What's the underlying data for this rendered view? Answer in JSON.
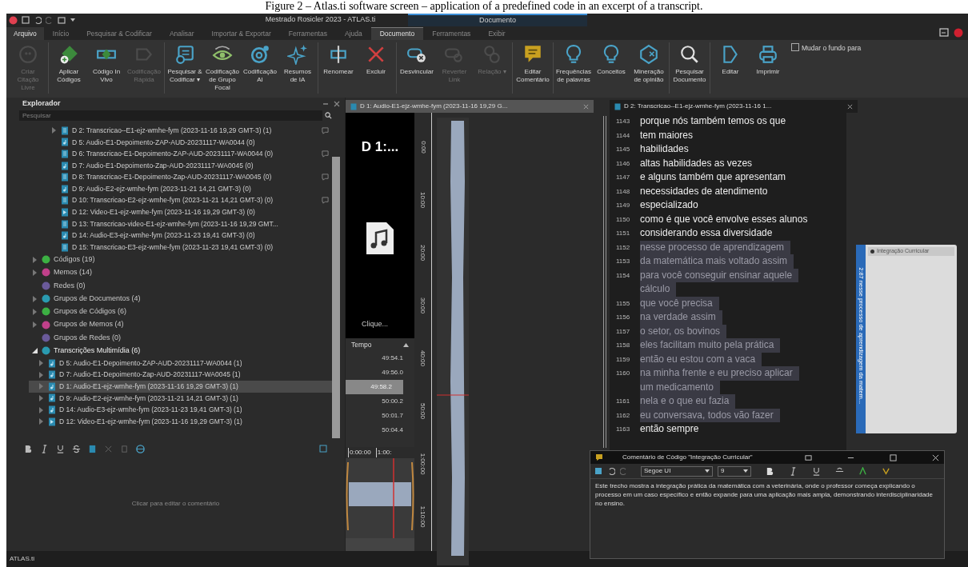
{
  "caption": "Figure 2 – Atlas.ti software screen – application of a predefined code in an excerpt of a transcript.",
  "window": {
    "title": "Mestrado Rosicler 2023 - ATLAS.ti",
    "contextual_tab": "Documento"
  },
  "ribbon_tabs": [
    {
      "label": "Arquivo",
      "kind": "menu",
      "selected": false
    },
    {
      "label": "Início",
      "kind": "tab",
      "selected": false
    },
    {
      "label": "Pesquisar & Codificar",
      "kind": "tab",
      "selected": false
    },
    {
      "label": "Analisar",
      "kind": "tab",
      "selected": false
    },
    {
      "label": "Importar & Exportar",
      "kind": "tab",
      "selected": false
    },
    {
      "label": "Ferramentas",
      "kind": "tab",
      "selected": false
    },
    {
      "label": "Ajuda",
      "kind": "tab",
      "selected": false
    },
    {
      "label": "Documento",
      "kind": "tab",
      "selected": true
    },
    {
      "label": "Ferramentas",
      "kind": "tab",
      "selected": false
    },
    {
      "label": "Exibir",
      "kind": "tab",
      "selected": false
    }
  ],
  "ribbon_groups": [
    [
      {
        "label": "Criar Citação Livre",
        "disabled": true
      }
    ],
    [
      {
        "label": "Aplicar Códigos",
        "disabled": false
      },
      {
        "label": "Código In Vivo",
        "disabled": false
      },
      {
        "label": "Codificação Rápida",
        "disabled": true
      }
    ],
    [
      {
        "label": "Pesquisar & Codificar ▾",
        "disabled": false
      },
      {
        "label": "Codificação de Grupo Focal",
        "disabled": false
      },
      {
        "label": "Codificação AI",
        "disabled": false
      },
      {
        "label": "Resumos de IA",
        "disabled": false
      }
    ],
    [
      {
        "label": "Renomear",
        "disabled": false
      },
      {
        "label": "Excluir",
        "disabled": false
      }
    ],
    [
      {
        "label": "Desvincular",
        "disabled": false
      },
      {
        "label": "Reverter Link",
        "disabled": true
      },
      {
        "label": "Relação ▾",
        "disabled": true
      }
    ],
    [
      {
        "label": "Editar Comentário",
        "disabled": false
      }
    ],
    [
      {
        "label": "Frequências de palavras",
        "disabled": false
      },
      {
        "label": "Conceitos",
        "disabled": false
      },
      {
        "label": "Mineração de opinião",
        "disabled": false
      }
    ],
    [
      {
        "label": "Pesquisar Documento",
        "disabled": false
      }
    ],
    [
      {
        "label": "Editar",
        "disabled": false
      },
      {
        "label": "Imprimir",
        "disabled": false
      }
    ]
  ],
  "background_checkbox": {
    "label": "Mudar o fundo para",
    "checked": false
  },
  "explorer": {
    "title": "Explorador",
    "search": {
      "placeholder": "Pesquisar"
    },
    "document_rows": [
      {
        "label": "D 2: Transcricao--E1-ejz-wmhe-fym (2023-11-16 19,29 GMT-3) (1)",
        "kind": "text",
        "expandable": true,
        "comment": true
      },
      {
        "label": "D 5: Audio-E1-Depoimento-ZAP-AUD-20231117-WA0044 (0)",
        "kind": "audio",
        "expandable": false,
        "comment": false
      },
      {
        "label": "D 6: Transcricao-E1-Depoimento-ZAP-AUD-20231117-WA0044 (0)",
        "kind": "text",
        "expandable": false,
        "comment": true
      },
      {
        "label": "D 7: Audio-E1-Depoimento-Zap-AUD-20231117-WA0045 (0)",
        "kind": "audio",
        "expandable": false,
        "comment": false
      },
      {
        "label": "D 8: Transcricao-E1-Depoimento-Zap-AUD-20231117-WA0045 (0)",
        "kind": "text",
        "expandable": false,
        "comment": true
      },
      {
        "label": "D 9: Audio-E2-ejz-wmhe-fym (2023-11-21 14,21 GMT-3) (0)",
        "kind": "audio",
        "expandable": false,
        "comment": false
      },
      {
        "label": "D 10: Transcricao-E2-ejz-wmhe-fym (2023-11-21 14,21 GMT-3) (0)",
        "kind": "text",
        "expandable": false,
        "comment": true
      },
      {
        "label": "D 12: Video-E1-ejz-wmhe-fym (2023-11-16 19,29 GMT-3) (0)",
        "kind": "video",
        "expandable": false,
        "comment": false
      },
      {
        "label": "D 13: Transcricao-video-E1-ejz-wmhe-fym (2023-11-16 19,29 GMT...",
        "kind": "text",
        "expandable": false,
        "comment": false
      },
      {
        "label": "D 14: Audio-E3-ejz-wmhe-fym (2023-11-23 19,41 GMT-3) (0)",
        "kind": "audio",
        "expandable": false,
        "comment": false
      },
      {
        "label": "D 15: Transcricao-E3-ejz-wmhe-fym (2023-11-23 19,41 GMT-3) (0)",
        "kind": "text",
        "expandable": false,
        "comment": false
      }
    ],
    "tree": [
      {
        "label": "Códigos (19)",
        "color": "#3cb043",
        "expandable": true,
        "expanded": false
      },
      {
        "label": "Memos (14)",
        "color": "#c0408a",
        "expandable": true,
        "expanded": false
      },
      {
        "label": "Redes (0)",
        "color": "#6a5a9a",
        "expandable": false,
        "expanded": false
      },
      {
        "label": "Grupos de Documentos (4)",
        "color": "#2a9ab0",
        "expandable": true,
        "expanded": false
      },
      {
        "label": "Grupos de Códigos (6)",
        "color": "#3cb043",
        "expandable": true,
        "expanded": false
      },
      {
        "label": "Grupos de Memos (4)",
        "color": "#c0408a",
        "expandable": true,
        "expanded": false
      },
      {
        "label": "Grupos de Redes (0)",
        "color": "#6a5a9a",
        "expandable": false,
        "expanded": false
      },
      {
        "label": "Transcrições Multimídia (6)",
        "color": "#2a9ab0",
        "expandable": true,
        "expanded": true,
        "children": [
          {
            "label": "D 5: Audio-E1-Depoimento-ZAP-AUD-20231117-WA0044 (1)",
            "kind": "audio",
            "selected": false
          },
          {
            "label": "D 7: Audio-E1-Depoimento-Zap-AUD-20231117-WA0045 (1)",
            "kind": "audio",
            "selected": false
          },
          {
            "label": "D 1: Audio-E1-ejz-wmhe-fym (2023-11-16 19,29 GMT-3) (1)",
            "kind": "audio",
            "selected": true
          },
          {
            "label": "D 9: Audio-E2-ejz-wmhe-fym (2023-11-21 14,21 GMT-3) (1)",
            "kind": "audio",
            "selected": false
          },
          {
            "label": "D 14: Audio-E3-ejz-wmhe-fym (2023-11-23 19,41 GMT-3) (1)",
            "kind": "audio",
            "selected": false
          },
          {
            "label": "D 12: Video-E1-ejz-wmhe-fym (2023-11-16 19,29 GMT-3) (1)",
            "kind": "video",
            "selected": false
          }
        ]
      }
    ],
    "comment_placeholder": "Clicar para editar o comentário"
  },
  "media_pane": {
    "tab": "D 1: Audio-E1-ejz-wmhe-fym (2023-11-16 19,29 G...",
    "preview_title": "D 1:...",
    "preview_hint": "Clique...",
    "time_header": "Tempo",
    "times": [
      {
        "label": "49:54.1",
        "selected": false
      },
      {
        "label": "49:56.0",
        "selected": false
      },
      {
        "label": "49:58.2",
        "selected": true
      },
      {
        "label": "50:00.2",
        "selected": false
      },
      {
        "label": "50:01.7",
        "selected": false
      },
      {
        "label": "50:04.4",
        "selected": false
      }
    ],
    "ruler": [
      "0:00",
      "10:00",
      "20:00",
      "30:00",
      "40:00",
      "50:00",
      "1:00:00",
      "1:10:00"
    ],
    "timeline": [
      "0:00:00",
      "1:00:"
    ]
  },
  "text_pane": {
    "tab": "D 2: Transcricao--E1-ejz-wmhe-fym (2023-11-16 1...",
    "lines": [
      {
        "number": "1143",
        "text": [
          "porque nós também temos os que"
        ],
        "coded": false
      },
      {
        "number": "1144",
        "text": [
          "tem maiores"
        ],
        "coded": false
      },
      {
        "number": "1145",
        "text": [
          "habilidades"
        ],
        "coded": false
      },
      {
        "number": "1146",
        "text": [
          "altas habilidades as vezes"
        ],
        "coded": false
      },
      {
        "number": "1147",
        "text": [
          "e alguns também que apresentam"
        ],
        "coded": false
      },
      {
        "number": "1148",
        "text": [
          "necessidades de atendimento"
        ],
        "coded": false
      },
      {
        "number": "1149",
        "text": [
          "especializado"
        ],
        "coded": false
      },
      {
        "number": "1150",
        "text": [
          "como é que você envolve esses alunos"
        ],
        "coded": false
      },
      {
        "number": "1151",
        "text": [
          "considerando essa diversidade"
        ],
        "coded": false
      },
      {
        "number": "1152",
        "text": [
          "nesse processo de aprendizagem"
        ],
        "coded": true
      },
      {
        "number": "1153",
        "text": [
          "da matemática mais voltado assim"
        ],
        "coded": true
      },
      {
        "number": "1154",
        "text": [
          "para você conseguir ensinar aquele",
          "cálculo"
        ],
        "coded": true
      },
      {
        "number": "1155",
        "text": [
          "que você precisa"
        ],
        "coded": true
      },
      {
        "number": "1156",
        "text": [
          "na verdade assim"
        ],
        "coded": true
      },
      {
        "number": "1157",
        "text": [
          "o setor, os bovinos"
        ],
        "coded": true
      },
      {
        "number": "1158",
        "text": [
          "eles facilitam muito pela prática"
        ],
        "coded": true
      },
      {
        "number": "1159",
        "text": [
          "então eu estou com a vaca"
        ],
        "coded": true
      },
      {
        "number": "1160",
        "text": [
          "na minha frente e eu preciso aplicar",
          "um medicamento"
        ],
        "coded": true
      },
      {
        "number": "1161",
        "text": [
          "nela e o que eu fazia"
        ],
        "coded": true
      },
      {
        "number": "1162",
        "text": [
          "eu conversava, todos vão fazer"
        ],
        "coded": true
      },
      {
        "number": "1163",
        "text": [
          "então sempre"
        ],
        "coded": false
      }
    ],
    "quotation_label": "2:87 nesse processo de aprendizagem da matem...",
    "code_tag": "Integração Curricular"
  },
  "comment_window": {
    "title": "Comentário de Código \"Integração Curricular\"",
    "font": "Segoe UI",
    "size": "9",
    "text": "Este trecho mostra a integração prática da matemática com a veterinária, onde o professor começa explicando o processo em um caso específico e então expande para uma aplicação mais ampla, demonstrando interdisciplinaridade no ensino."
  },
  "status_bar": "ATLAS.ti"
}
